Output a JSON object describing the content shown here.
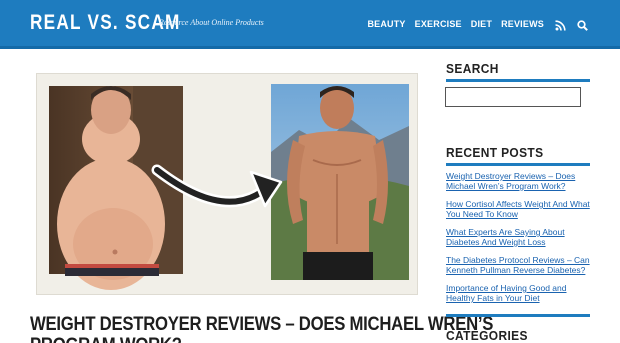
{
  "site": {
    "logo": "REAL VS. SCAM",
    "tagline": "Resource About Online Products"
  },
  "nav": {
    "items": [
      "BEAUTY",
      "EXERCISE",
      "DIET",
      "REVIEWS"
    ],
    "icons": [
      "rss-icon",
      "search-icon"
    ]
  },
  "post": {
    "title_line1": "WEIGHT DESTROYER REVIEWS – DOES MICHAEL WREN’S",
    "title_line2": "PROGRAM WORK?"
  },
  "sidebar": {
    "search_title": "SEARCH",
    "search_placeholder": "",
    "recent_title": "RECENT POSTS",
    "recent_posts": [
      "Weight Destroyer Reviews – Does Michael Wren’s Program Work?",
      "How Cortisol Affects Weight And What You Need To Know",
      "What Experts Are Saying About Diabetes And Weight Loss",
      "The Diabetes Protocol Reviews – Can Kenneth Pullman Reverse Diabetes?",
      "Importance of Having Good and Healthy Fats in Your Diet"
    ],
    "categories_title": "CATEGORIES"
  },
  "colors": {
    "header": "#1e7cbf",
    "link": "#1a63b0",
    "rule": "#1e7cbf"
  }
}
